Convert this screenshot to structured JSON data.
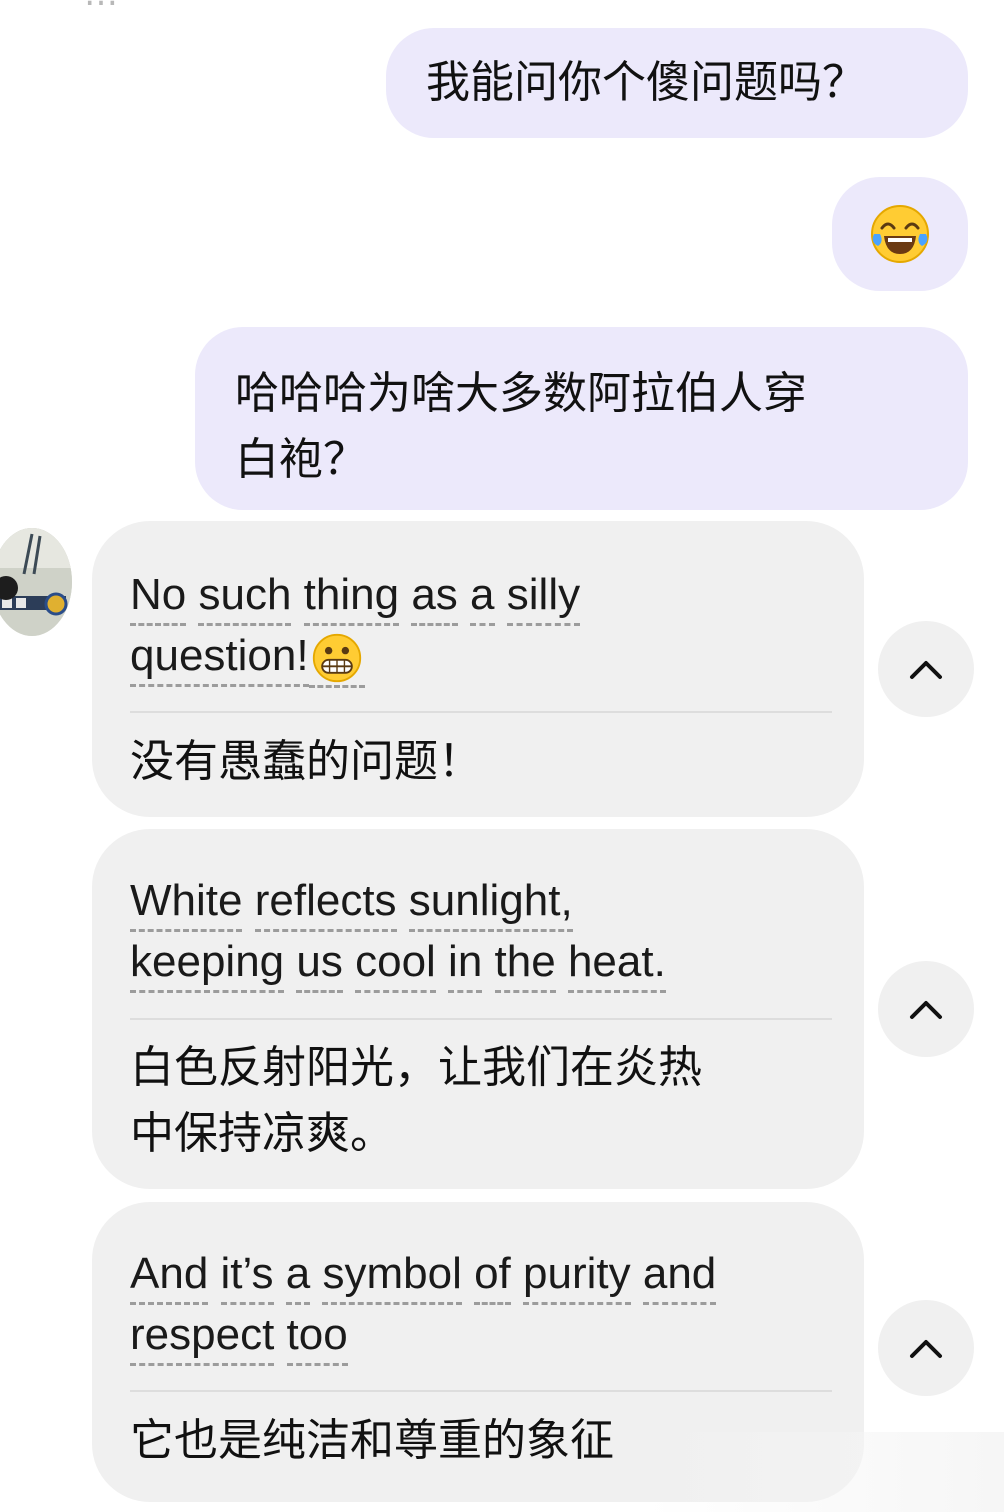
{
  "top_fragment": "…",
  "outgoing": [
    {
      "text": "我能问你个傻问题吗？"
    },
    {
      "emoji": "face-with-tears-of-joy"
    },
    {
      "text_line1": "哈哈哈为啥大多数阿拉伯人穿",
      "text_line2": "白袍？"
    }
  ],
  "incoming": [
    {
      "en_words_line1": [
        "No",
        "such",
        "thing",
        "as",
        "a",
        "silly"
      ],
      "en_words_line2": [
        "question!"
      ],
      "emoji": "grinning-face-emoji",
      "cn": "没有愚蠢的问题！"
    },
    {
      "en_words_line1": [
        "White",
        "reflects",
        "sunlight,"
      ],
      "en_words_line2": [
        "keeping",
        "us",
        "cool",
        "in",
        "the",
        "heat."
      ],
      "cn_line1": "白色反射阳光，让我们在炎热",
      "cn_line2": "中保持凉爽。"
    },
    {
      "en_words_line1": [
        "And",
        "it’s",
        "a",
        "symbol",
        "of",
        "purity",
        "and"
      ],
      "en_words_line2": [
        "respect",
        "too"
      ],
      "cn": "它也是纯洁和尊重的象征"
    }
  ],
  "colors": {
    "outgoing_bubble": "#ece9fb",
    "incoming_bubble": "#f0f0f0",
    "underline": "#9c9c9c"
  },
  "icons": {
    "collapse": "chevron-up-icon",
    "avatar": "avatar"
  }
}
